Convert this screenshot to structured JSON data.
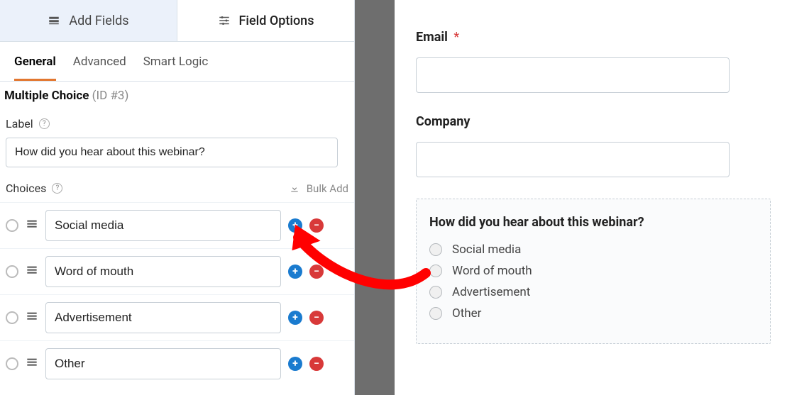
{
  "top_tabs": {
    "add_fields": "Add Fields",
    "field_options": "Field Options"
  },
  "sub_tabs": {
    "general": "General",
    "advanced": "Advanced",
    "smart_logic": "Smart Logic"
  },
  "field": {
    "type": "Multiple Choice",
    "id_label": "(ID #3)"
  },
  "label_section": {
    "title": "Label",
    "value": "How did you hear about this webinar?"
  },
  "choices_section": {
    "title": "Choices",
    "bulk_add": "Bulk Add",
    "items": [
      {
        "value": "Social media"
      },
      {
        "value": "Word of mouth"
      },
      {
        "value": "Advertisement"
      },
      {
        "value": "Other"
      }
    ]
  },
  "preview": {
    "email": {
      "label": "Email"
    },
    "company": {
      "label": "Company"
    },
    "question": {
      "label": "How did you hear about this webinar?",
      "options": [
        "Social media",
        "Word of mouth",
        "Advertisement",
        "Other"
      ]
    }
  }
}
